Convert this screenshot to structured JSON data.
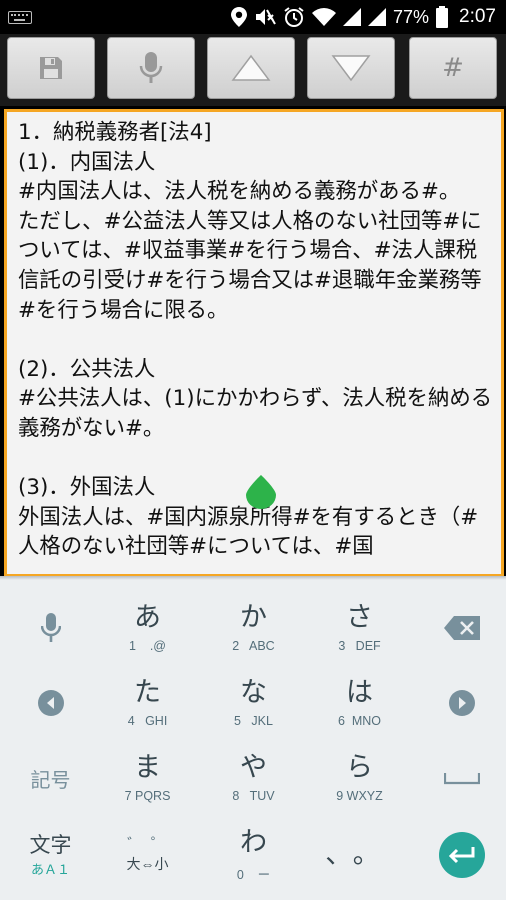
{
  "status_bar": {
    "battery_percent": "77%",
    "time": "2:07"
  },
  "toolbar": {
    "hash_label": "#"
  },
  "editor": {
    "text": "1．納税義務者[法4]\n(1)．内国法人\n#内国法人は、法人税を納める義務がある#。\nただし、#公益法人等又は人格のない社団等#については、#収益事業#を行う場合、#法人課税信託の引受け#を行う場合又は#退職年金業務等#を行う場合に限る。\n\n(2)．公共法人\n#公共法人は、(1)にかかわらず、法人税を納める義務がない#。\n\n(3)．外国法人\n外国法人は、#国内源泉所得#を有するとき（#人格のない社団等#については、#国"
  },
  "keyboard": {
    "rows": [
      [
        {
          "main": "あ",
          "sub": "1    .@"
        },
        {
          "main": "か",
          "sub": "2   ABC"
        },
        {
          "main": "さ",
          "sub": "3   DEF"
        }
      ],
      [
        {
          "main": "た",
          "sub": "4   GHI"
        },
        {
          "main": "な",
          "sub": "5   JKL"
        },
        {
          "main": "は",
          "sub": "6  MNO"
        }
      ],
      [
        {
          "main": "ま",
          "sub": "7 PQRS"
        },
        {
          "main": "や",
          "sub": "8   TUV"
        },
        {
          "main": "ら",
          "sub": "9 WXYZ"
        }
      ],
      [
        {
          "main": "わ",
          "sub": "0    ー"
        },
        {
          "main": "、。",
          "sub": ""
        }
      ]
    ],
    "kigou_label": "記号",
    "moji_label": "文字",
    "moji_sub": "あＡ１",
    "daisho_top": "゛ ゜",
    "daisho_label": "大⇔小"
  },
  "colors": {
    "editor_border": "#f5a623",
    "accent": "#26a69a",
    "cursor_handle": "#2db34a"
  }
}
